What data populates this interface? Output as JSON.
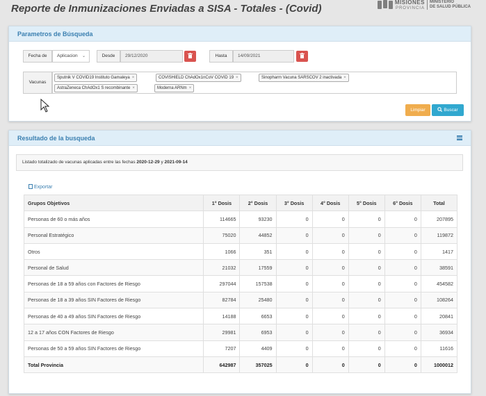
{
  "page_title": "Reporte de Inmunizaciones Enviadas a SISA - Totales - (Covid)",
  "logo": {
    "main": "MISIONES",
    "sub": "PROVINCIA",
    "right_line1": "MINISTERIO",
    "right_line2": "DE SALUD PÚBLICA"
  },
  "search_panel": {
    "title": "Parametros de Búsqueda",
    "fecha_label": "Fecha de",
    "fecha_select": "Aplicacion",
    "desde_label": "Desde",
    "desde_value": "29/12/2020",
    "hasta_label": "Hasta",
    "hasta_value": "14/09/2021",
    "vacunas_label": "Vacunas",
    "vacunas": [
      "Sputnik V COVID19 Instituto Gamaleya",
      "COVISHIELD ChAdOx1nCoV COVID 19",
      "Sinopharm Vacuna SARSCOV 2 inactivada",
      "AstraZeneca ChAdOx1 S recombinante",
      "Moderna ARNm"
    ],
    "clear_label": "Limpiar",
    "search_label": "Buscar"
  },
  "results_panel": {
    "title": "Resultado de la busqueda",
    "summary_text": "Listado totalizado de vacunas aplicadas entre las fechas ",
    "summary_from": "2020-12-29",
    "summary_and": " y ",
    "summary_to": "2021-09-14",
    "export_label": "Exportar",
    "columns": [
      "Grupos Objetivos",
      "1° Dosis",
      "2° Dosis",
      "3° Dosis",
      "4° Dosis",
      "5° Dosis",
      "6° Dosis",
      "Total"
    ],
    "rows": [
      [
        "Personas de 60 o más años",
        "114665",
        "93230",
        "0",
        "0",
        "0",
        "0",
        "207895"
      ],
      [
        "Personal Estratégico",
        "75020",
        "44852",
        "0",
        "0",
        "0",
        "0",
        "119872"
      ],
      [
        "Otros",
        "1066",
        "351",
        "0",
        "0",
        "0",
        "0",
        "1417"
      ],
      [
        "Personal de Salud",
        "21032",
        "17559",
        "0",
        "0",
        "0",
        "0",
        "38591"
      ],
      [
        "Personas de 18 a 59 años con Factores de Riesgo",
        "297044",
        "157538",
        "0",
        "0",
        "0",
        "0",
        "454582"
      ],
      [
        "Personas de 18 a 39 años SIN Factores de Riesgo",
        "82784",
        "25480",
        "0",
        "0",
        "0",
        "0",
        "108264"
      ],
      [
        "Personas de 40 a 49 años SIN Factores de Riesgo",
        "14188",
        "6653",
        "0",
        "0",
        "0",
        "0",
        "20841"
      ],
      [
        "12 a 17 años CON Factores de Riesgo",
        "29981",
        "6953",
        "0",
        "0",
        "0",
        "0",
        "36934"
      ],
      [
        "Personas de 50 a 59 años SIN Factores de Riesgo",
        "7207",
        "4409",
        "0",
        "0",
        "0",
        "0",
        "11616"
      ]
    ],
    "total_row": [
      "Total Provincia",
      "642987",
      "357025",
      "0",
      "0",
      "0",
      "0",
      "1000012"
    ]
  },
  "icons": [
    "trash-icon",
    "search-icon",
    "list-icon",
    "export-icon",
    "cursor-icon"
  ],
  "colors": {
    "accent": "#3a7fb0",
    "danger": "#d9534f",
    "warning": "#f0ad4e",
    "info": "#31a8cf"
  }
}
